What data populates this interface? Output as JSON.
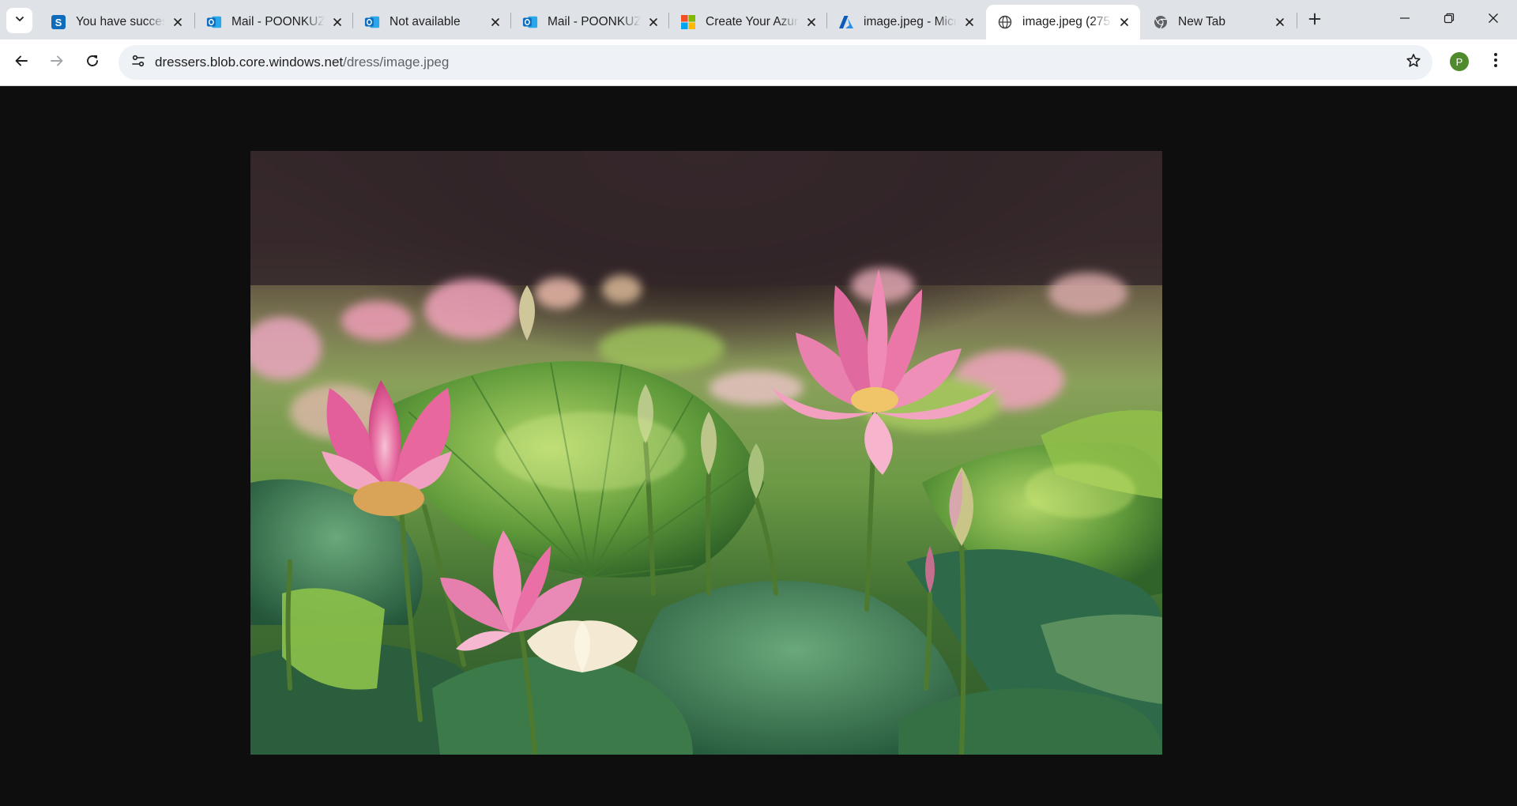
{
  "browser": {
    "tabs": [
      {
        "title": "You have successfully",
        "favicon": "sharepoint-icon",
        "active": false
      },
      {
        "title": "Mail - POONKUZHALI",
        "favicon": "outlook-icon",
        "active": false
      },
      {
        "title": "Not available",
        "favicon": "outlook-icon",
        "active": false
      },
      {
        "title": "Mail - POONKUZHALI",
        "favicon": "outlook-icon",
        "active": false
      },
      {
        "title": "Create Your Azure",
        "favicon": "microsoft-icon",
        "active": false
      },
      {
        "title": "image.jpeg - Microsoft",
        "favicon": "azure-icon",
        "active": false
      },
      {
        "title": "image.jpeg (275",
        "favicon": "globe-icon",
        "active": true
      },
      {
        "title": "New Tab",
        "favicon": "chrome-icon",
        "active": false
      }
    ],
    "address": {
      "host": "dressers.blob.core.windows.net",
      "path": "/dress/image.jpeg"
    },
    "profile_initial": "P",
    "colors": {
      "tabstrip": "#dfe3e8",
      "viewer_background": "#0e0e0e",
      "profile": "#4f8a2c"
    }
  },
  "viewer": {
    "image_subject": "pink lotus flowers among green lotus leaves"
  }
}
